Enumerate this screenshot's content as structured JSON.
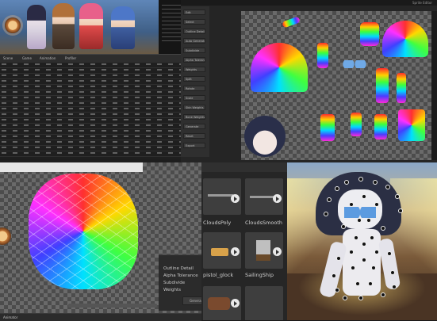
{
  "top_left": {
    "menu_items": [
      "Scene",
      "Game",
      "Animation",
      "Profiler"
    ],
    "graph_label": "Profiler"
  },
  "top_right": {
    "side_buttons": [
      "Edit",
      "Select",
      "Outline Detail",
      "Auto Generate",
      "Subdivide",
      "Alpha Tolerance",
      "Weights",
      "Split",
      "Rotate",
      "Scale",
      "Skin Weights",
      "Bone Weights",
      "Generate",
      "Reset",
      "Export"
    ],
    "corner_label": "Sprite Editor"
  },
  "asset_panel": {
    "items": [
      {
        "label": "CloudsPoly"
      },
      {
        "label": "CloudsSmooth"
      },
      {
        "label": "pistol_glock"
      },
      {
        "label": "SailingShip"
      },
      {
        "label": ""
      },
      {
        "label": ""
      }
    ]
  },
  "mesh_editor": {
    "properties": [
      "Outline Detail",
      "Alpha Tolerance",
      "Subdivide",
      "Weights"
    ],
    "generate_button": "Genera"
  },
  "bottom_bar": {
    "animator_tab": "Animator"
  },
  "colors": {
    "editor_bg": "#1e1e1e",
    "panel_bg": "#2b2b2b",
    "accent": "#3a6fbf",
    "scene_sky": "#7aa7d8"
  }
}
